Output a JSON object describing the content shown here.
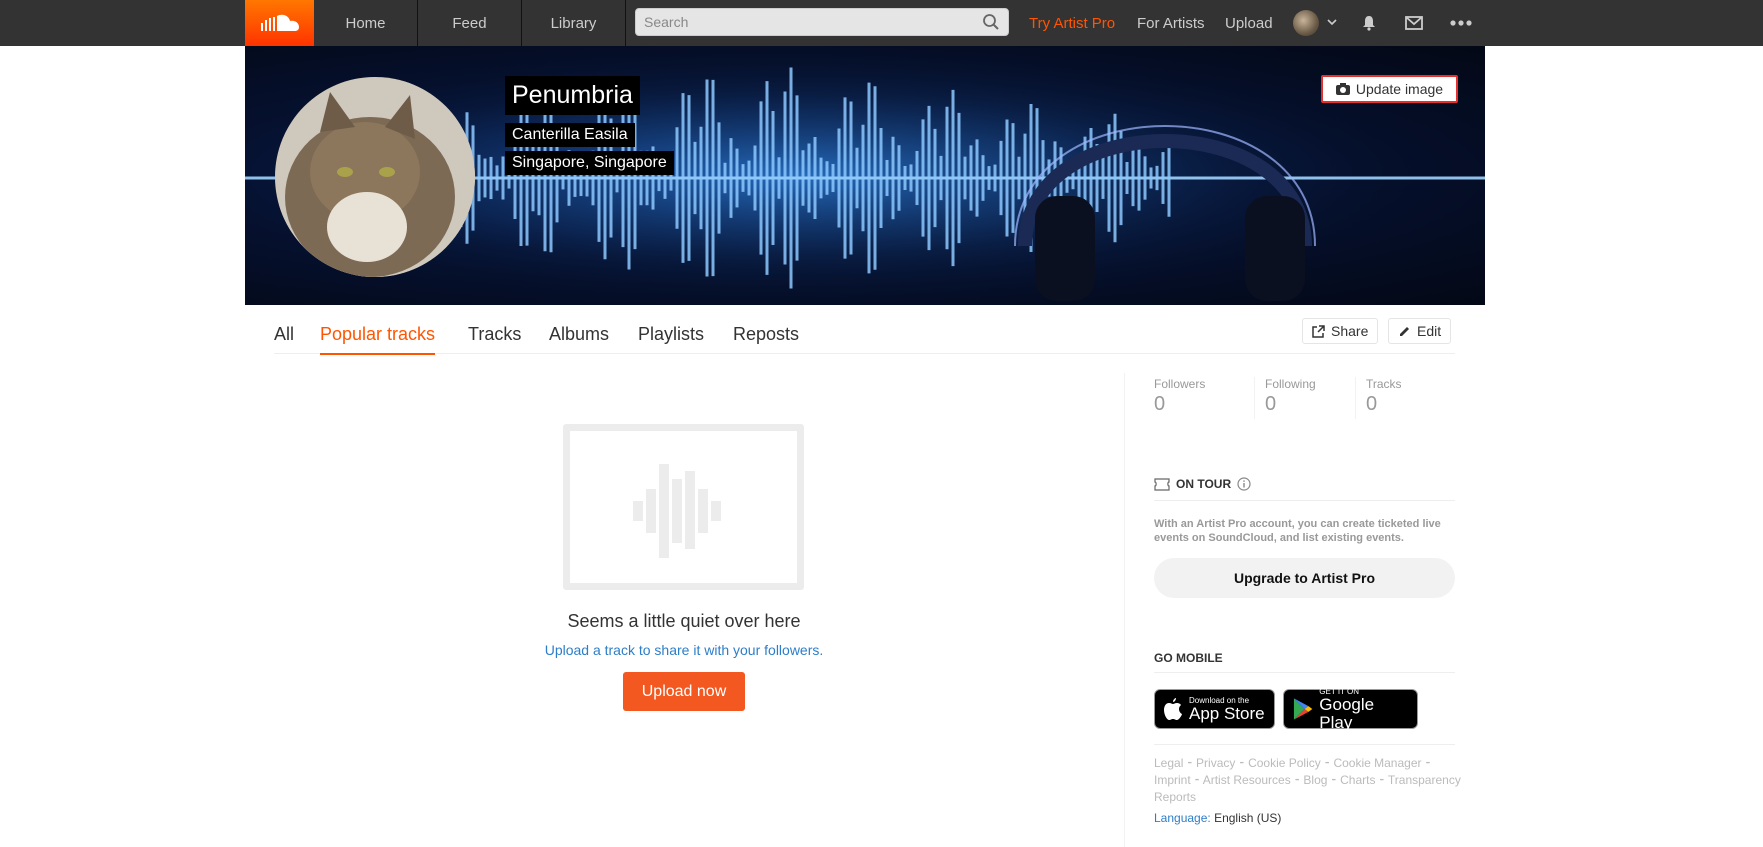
{
  "header": {
    "nav": [
      "Home",
      "Feed",
      "Library"
    ],
    "search_placeholder": "Search",
    "try_pro": "Try Artist Pro",
    "for_artists": "For Artists",
    "upload": "Upload"
  },
  "banner": {
    "update_image": "Update image",
    "display_name": "Penumbria",
    "full_name": "Canterilla Easila",
    "location": "Singapore, Singapore"
  },
  "tabs": {
    "items": [
      "All",
      "Popular tracks",
      "Tracks",
      "Albums",
      "Playlists",
      "Reposts"
    ],
    "active": "Popular tracks",
    "share": "Share",
    "edit": "Edit"
  },
  "empty": {
    "title": "Seems a little quiet over here",
    "link": "Upload a track to share it with your followers.",
    "button": "Upload now"
  },
  "stats": [
    {
      "label": "Followers",
      "value": "0"
    },
    {
      "label": "Following",
      "value": "0"
    },
    {
      "label": "Tracks",
      "value": "0"
    }
  ],
  "on_tour": {
    "heading": "ON TOUR",
    "text": "With an Artist Pro account, you can create ticketed live events on SoundCloud, and list existing events.",
    "button": "Upgrade to Artist Pro"
  },
  "go_mobile": {
    "heading": "GO MOBILE",
    "app_store_small": "Download on the",
    "app_store_big": "App Store",
    "google_small": "GET IT ON",
    "google_big": "Google Play"
  },
  "footer": {
    "links": [
      "Legal",
      "Privacy",
      "Cookie Policy",
      "Cookie Manager",
      "Imprint",
      "Artist Resources",
      "Blog",
      "Charts",
      "Transparency Reports"
    ],
    "language_label": "Language:",
    "language_value": "English (US)"
  },
  "colors": {
    "accent": "#ff5500",
    "link": "#2d7ec9",
    "header_bg": "#333333"
  }
}
